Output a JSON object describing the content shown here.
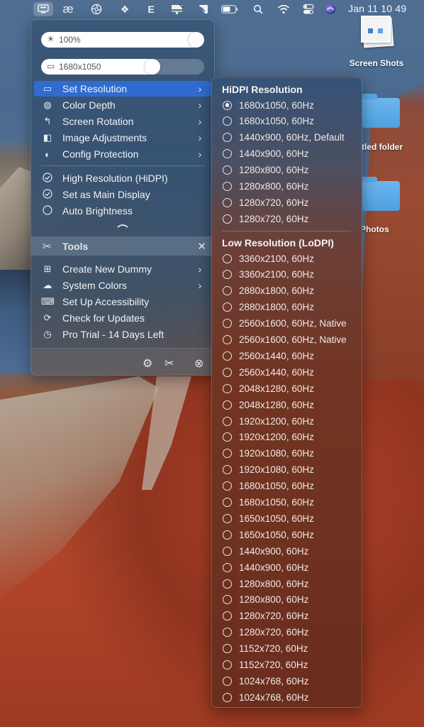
{
  "menubar": {
    "icons": [
      {
        "name": "display-icon",
        "glyph": "▭",
        "active": true
      },
      {
        "name": "ae-icon",
        "glyph": "æ"
      },
      {
        "name": "aperture-icon",
        "glyph": "◎"
      },
      {
        "name": "dropbox-icon",
        "glyph": "❖"
      },
      {
        "name": "e-icon",
        "glyph": "E"
      },
      {
        "name": "screen-share-icon",
        "glyph": "▨"
      },
      {
        "name": "pen-icon",
        "glyph": "◪"
      },
      {
        "name": "battery-icon",
        "glyph": "▭"
      },
      {
        "name": "search-icon",
        "glyph": "⚲"
      },
      {
        "name": "wifi-icon",
        "glyph": "◠"
      },
      {
        "name": "control-center-icon",
        "glyph": "☰"
      },
      {
        "name": "siri-icon",
        "glyph": "●"
      }
    ],
    "clock": "Jan 11  10 49"
  },
  "desktop": {
    "items": [
      {
        "label": "Screen Shots"
      },
      {
        "label": "tled folder"
      },
      {
        "label": "Photos"
      }
    ]
  },
  "main_menu": {
    "brightness": {
      "icon": "☀",
      "label": "100%",
      "value_percent": 100
    },
    "resolution": {
      "icon": "▭",
      "label": "1680x1050",
      "value_fraction": 0.7
    },
    "items": [
      {
        "label": "Set Resolution",
        "icon": "▭",
        "submenu": true,
        "highlighted": true
      },
      {
        "label": "Color Depth",
        "icon": "◍",
        "submenu": true
      },
      {
        "label": "Screen Rotation",
        "icon": "↰",
        "submenu": true
      },
      {
        "label": "Image Adjustments",
        "icon": "◧",
        "submenu": true
      },
      {
        "label": "Config Protection",
        "icon": "◐",
        "submenu": true
      }
    ],
    "toggles": [
      {
        "label": "High Resolution (HiDPI)",
        "icon": "✓",
        "checked": true
      },
      {
        "label": "Set as Main Display",
        "icon": "✓",
        "checked": true
      },
      {
        "label": "Auto Brightness",
        "icon": "○",
        "checked": false
      }
    ],
    "collapse_glyph": "︿",
    "tools": {
      "title": "Tools",
      "icon": "✂",
      "close_glyph": "✕",
      "items": [
        {
          "label": "Create New Dummy",
          "icon": "⊞",
          "submenu": true
        },
        {
          "label": "System Colors",
          "icon": "☁",
          "submenu": true
        },
        {
          "label": "Set Up Accessibility",
          "icon": "⌨",
          "submenu": false
        },
        {
          "label": "Check for Updates",
          "icon": "⟳",
          "submenu": false
        },
        {
          "label": "Pro Trial - 14 Days Left",
          "icon": "◷",
          "submenu": false
        }
      ]
    },
    "footer": {
      "settings_glyph": "⚙",
      "tools_glyph": "✂",
      "quit_glyph": "⊗"
    },
    "chevron": "›"
  },
  "submenu": {
    "hidpi_title": "HiDPI Resolution",
    "hidpi": [
      {
        "label": "1680x1050, 60Hz",
        "selected": true
      },
      {
        "label": "1680x1050, 60Hz",
        "selected": false
      },
      {
        "label": "1440x900, 60Hz, Default",
        "selected": false
      },
      {
        "label": "1440x900, 60Hz",
        "selected": false
      },
      {
        "label": "1280x800, 60Hz",
        "selected": false
      },
      {
        "label": "1280x800, 60Hz",
        "selected": false
      },
      {
        "label": "1280x720, 60Hz",
        "selected": false
      },
      {
        "label": "1280x720, 60Hz",
        "selected": false
      }
    ],
    "lodpi_title": "Low Resolution (LoDPI)",
    "lodpi": [
      {
        "label": "3360x2100, 60Hz"
      },
      {
        "label": "3360x2100, 60Hz"
      },
      {
        "label": "2880x1800, 60Hz"
      },
      {
        "label": "2880x1800, 60Hz"
      },
      {
        "label": "2560x1600, 60Hz, Native"
      },
      {
        "label": "2560x1600, 60Hz, Native"
      },
      {
        "label": "2560x1440, 60Hz"
      },
      {
        "label": "2560x1440, 60Hz"
      },
      {
        "label": "2048x1280, 60Hz"
      },
      {
        "label": "2048x1280, 60Hz"
      },
      {
        "label": "1920x1200, 60Hz"
      },
      {
        "label": "1920x1200, 60Hz"
      },
      {
        "label": "1920x1080, 60Hz"
      },
      {
        "label": "1920x1080, 60Hz"
      },
      {
        "label": "1680x1050, 60Hz"
      },
      {
        "label": "1680x1050, 60Hz"
      },
      {
        "label": "1650x1050, 60Hz"
      },
      {
        "label": "1650x1050, 60Hz"
      },
      {
        "label": "1440x900, 60Hz"
      },
      {
        "label": "1440x900, 60Hz"
      },
      {
        "label": "1280x800, 60Hz"
      },
      {
        "label": "1280x800, 60Hz"
      },
      {
        "label": "1280x720, 60Hz"
      },
      {
        "label": "1280x720, 60Hz"
      },
      {
        "label": "1152x720, 60Hz"
      },
      {
        "label": "1152x720, 60Hz"
      },
      {
        "label": "1024x768, 60Hz"
      },
      {
        "label": "1024x768, 60Hz"
      }
    ]
  },
  "colors": {
    "highlight": "#2f6bd1"
  }
}
